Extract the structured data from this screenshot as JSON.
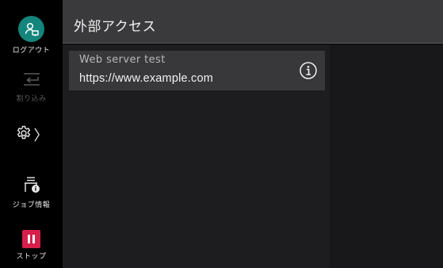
{
  "nav": {
    "logout_label": "ログアウト",
    "interrupt_label": "割り込み",
    "job_info_label": "ジョブ情報",
    "stop_label": "ストップ",
    "settings_chevron": "〉",
    "accent_logout": "#14857c",
    "accent_stop": "#d61f4a"
  },
  "header": {
    "title": "外部アクセス"
  },
  "list": {
    "items": [
      {
        "name": "Web server test",
        "url": "https://www.example.com",
        "icon": "info-circle-icon"
      }
    ]
  }
}
